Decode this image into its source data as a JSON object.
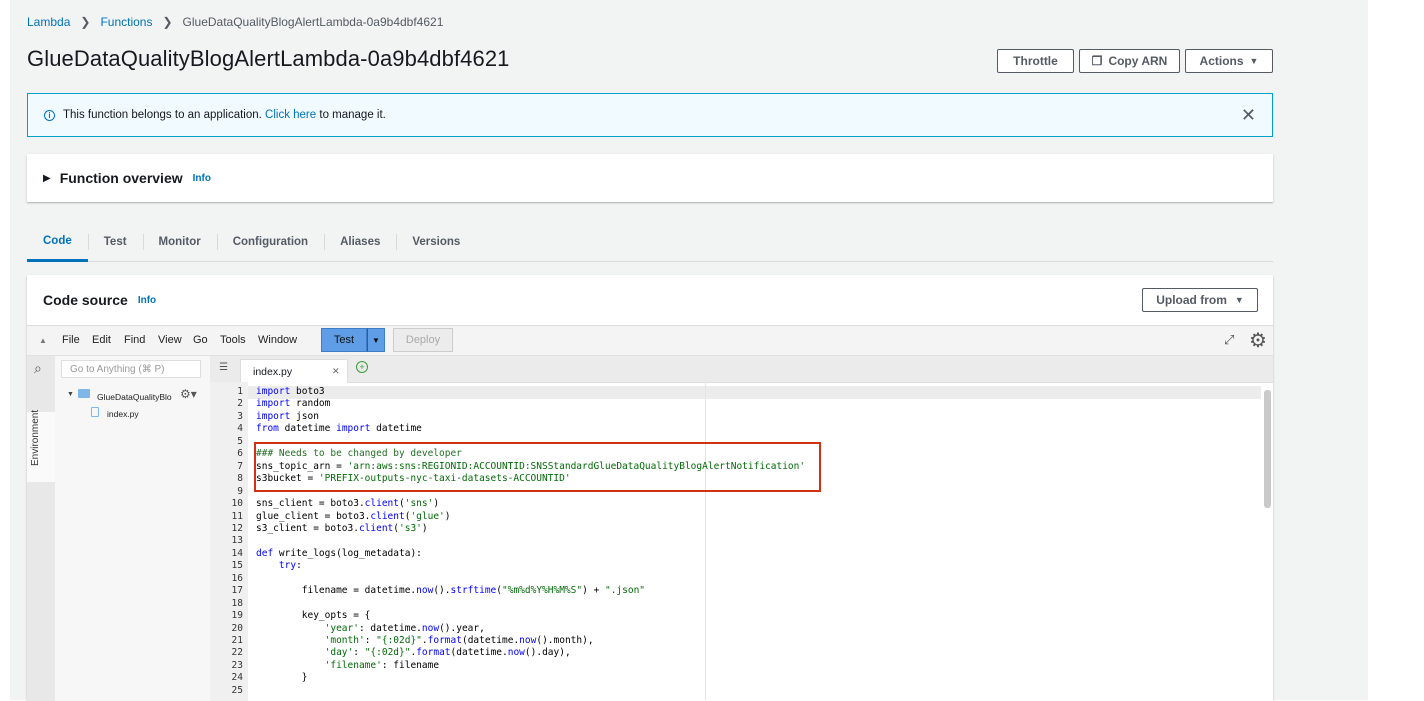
{
  "breadcrumb": {
    "items": [
      "Lambda",
      "Functions",
      "GlueDataQualityBlogAlertLambda-0a9b4dbf4621"
    ]
  },
  "page": {
    "title": "GlueDataQualityBlogAlertLambda-0a9b4dbf4621"
  },
  "header_buttons": {
    "throttle": "Throttle",
    "copy_arn": "Copy ARN",
    "actions": "Actions"
  },
  "alert": {
    "text_before": "This function belongs to an application.",
    "link": "Click here",
    "text_after": "to manage it."
  },
  "overview": {
    "title": "Function overview",
    "info": "Info"
  },
  "tabs": [
    "Code",
    "Test",
    "Monitor",
    "Configuration",
    "Aliases",
    "Versions"
  ],
  "code_source": {
    "title": "Code source",
    "info": "Info",
    "upload_label": "Upload from"
  },
  "ide": {
    "menu": [
      "File",
      "Edit",
      "Find",
      "View",
      "Go",
      "Tools",
      "Window"
    ],
    "test_label": "Test",
    "deploy_label": "Deploy",
    "search_placeholder": "Go to Anything (⌘ P)",
    "environment_label": "Environment",
    "folder_name": "GlueDataQualityBlo",
    "file_name": "index.py",
    "open_tab": "index.py"
  },
  "code": {
    "line_numbers": [
      "1",
      "2",
      "3",
      "4",
      "5",
      "6",
      "7",
      "8",
      "9",
      "10",
      "11",
      "12",
      "13",
      "14",
      "15",
      "16",
      "17",
      "18",
      "19",
      "20",
      "21",
      "22",
      "23",
      "24",
      "25"
    ],
    "lines": [
      "import boto3",
      "import random",
      "import json",
      "from datetime import datetime",
      "",
      "### Needs to be changed by developer",
      "sns_topic_arn = 'arn:aws:sns:REGIONID:ACCOUNTID:SNSStandardGlueDataQualityBlogAlertNotification'",
      "s3bucket = 'PREFIX-outputs-nyc-taxi-datasets-ACCOUNTID'",
      "",
      "sns_client = boto3.client('sns')",
      "glue_client = boto3.client('glue')",
      "s3_client = boto3.client('s3')",
      "",
      "def write_logs(log_metadata):",
      "    try:",
      "",
      "        filename = datetime.now().strftime(\"%m%d%Y%H%M%S\") + \".json\"",
      "",
      "        key_opts = {",
      "            'year': datetime.now().year,",
      "            'month': \"{:02d}\".format(datetime.now().month),",
      "            'day': \"{:02d}\".format(datetime.now().day),",
      "            'filename': filename",
      "        }",
      ""
    ]
  },
  "colors": {
    "link": "#0073bb",
    "alert_border": "#00a1c9",
    "alert_bg": "#f1faff",
    "test_button": "#5f9de6",
    "highlight_box": "#d13212"
  }
}
